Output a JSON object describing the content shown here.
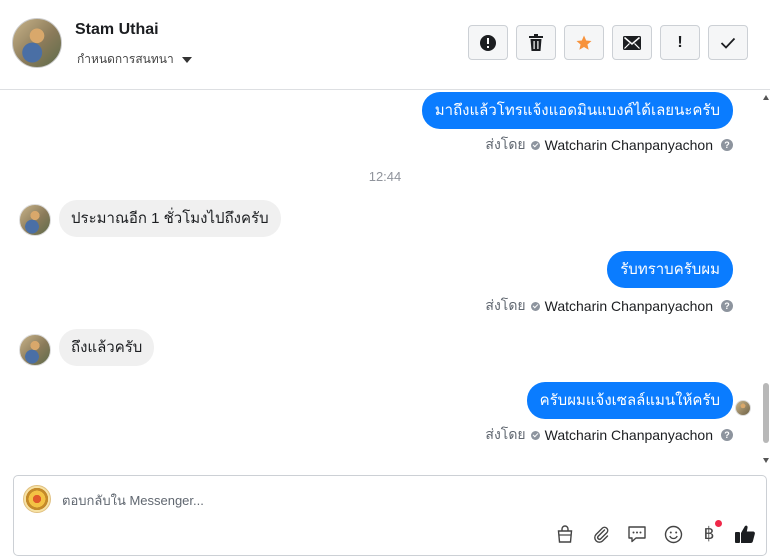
{
  "header": {
    "contact_name": "Stam Uthai",
    "assign_label": "กำหนดการสนทนา",
    "actions": [
      {
        "name": "spam",
        "icon": "alert-circle-icon"
      },
      {
        "name": "delete",
        "icon": "trash-icon"
      },
      {
        "name": "star",
        "icon": "star-icon",
        "color": "#f7923b"
      },
      {
        "name": "mark-unread",
        "icon": "envelope-icon"
      },
      {
        "name": "follow-up",
        "icon": "exclamation-icon",
        "label": "!"
      },
      {
        "name": "done",
        "icon": "checkmark-icon"
      }
    ]
  },
  "thread": {
    "messages": [
      {
        "direction": "out",
        "text": "มาถึงแล้วโทรแจ้งแอดมินแบงค์ได้เลยนะครับ",
        "sent_by_prefix": "ส่งโดย",
        "sent_by_name": "Watcharin Chanpanyachon"
      },
      {
        "type": "timestamp",
        "text": "12:44"
      },
      {
        "direction": "in",
        "text": "ประมาณอีก 1 ชั่วโมงไปถึงครับ"
      },
      {
        "direction": "out",
        "text": "รับทราบครับผม",
        "sent_by_prefix": "ส่งโดย",
        "sent_by_name": "Watcharin Chanpanyachon"
      },
      {
        "direction": "in",
        "text": "ถึงแล้วครับ"
      },
      {
        "direction": "out",
        "text": "ครับผมแจ้งเซลล์แมนให้ครับ",
        "sent_by_prefix": "ส่งโดย",
        "sent_by_name": "Watcharin Chanpanyachon",
        "seen": true
      }
    ]
  },
  "composer": {
    "placeholder": "ตอบกลับใน Messenger...",
    "tools": [
      "shopping-bag-icon",
      "paperclip-icon",
      "saved-reply-icon",
      "emoji-icon",
      "baht-payment-icon",
      "thumbs-up-icon"
    ],
    "payment_symbol": "฿",
    "accent_color": "#0a7cff"
  }
}
